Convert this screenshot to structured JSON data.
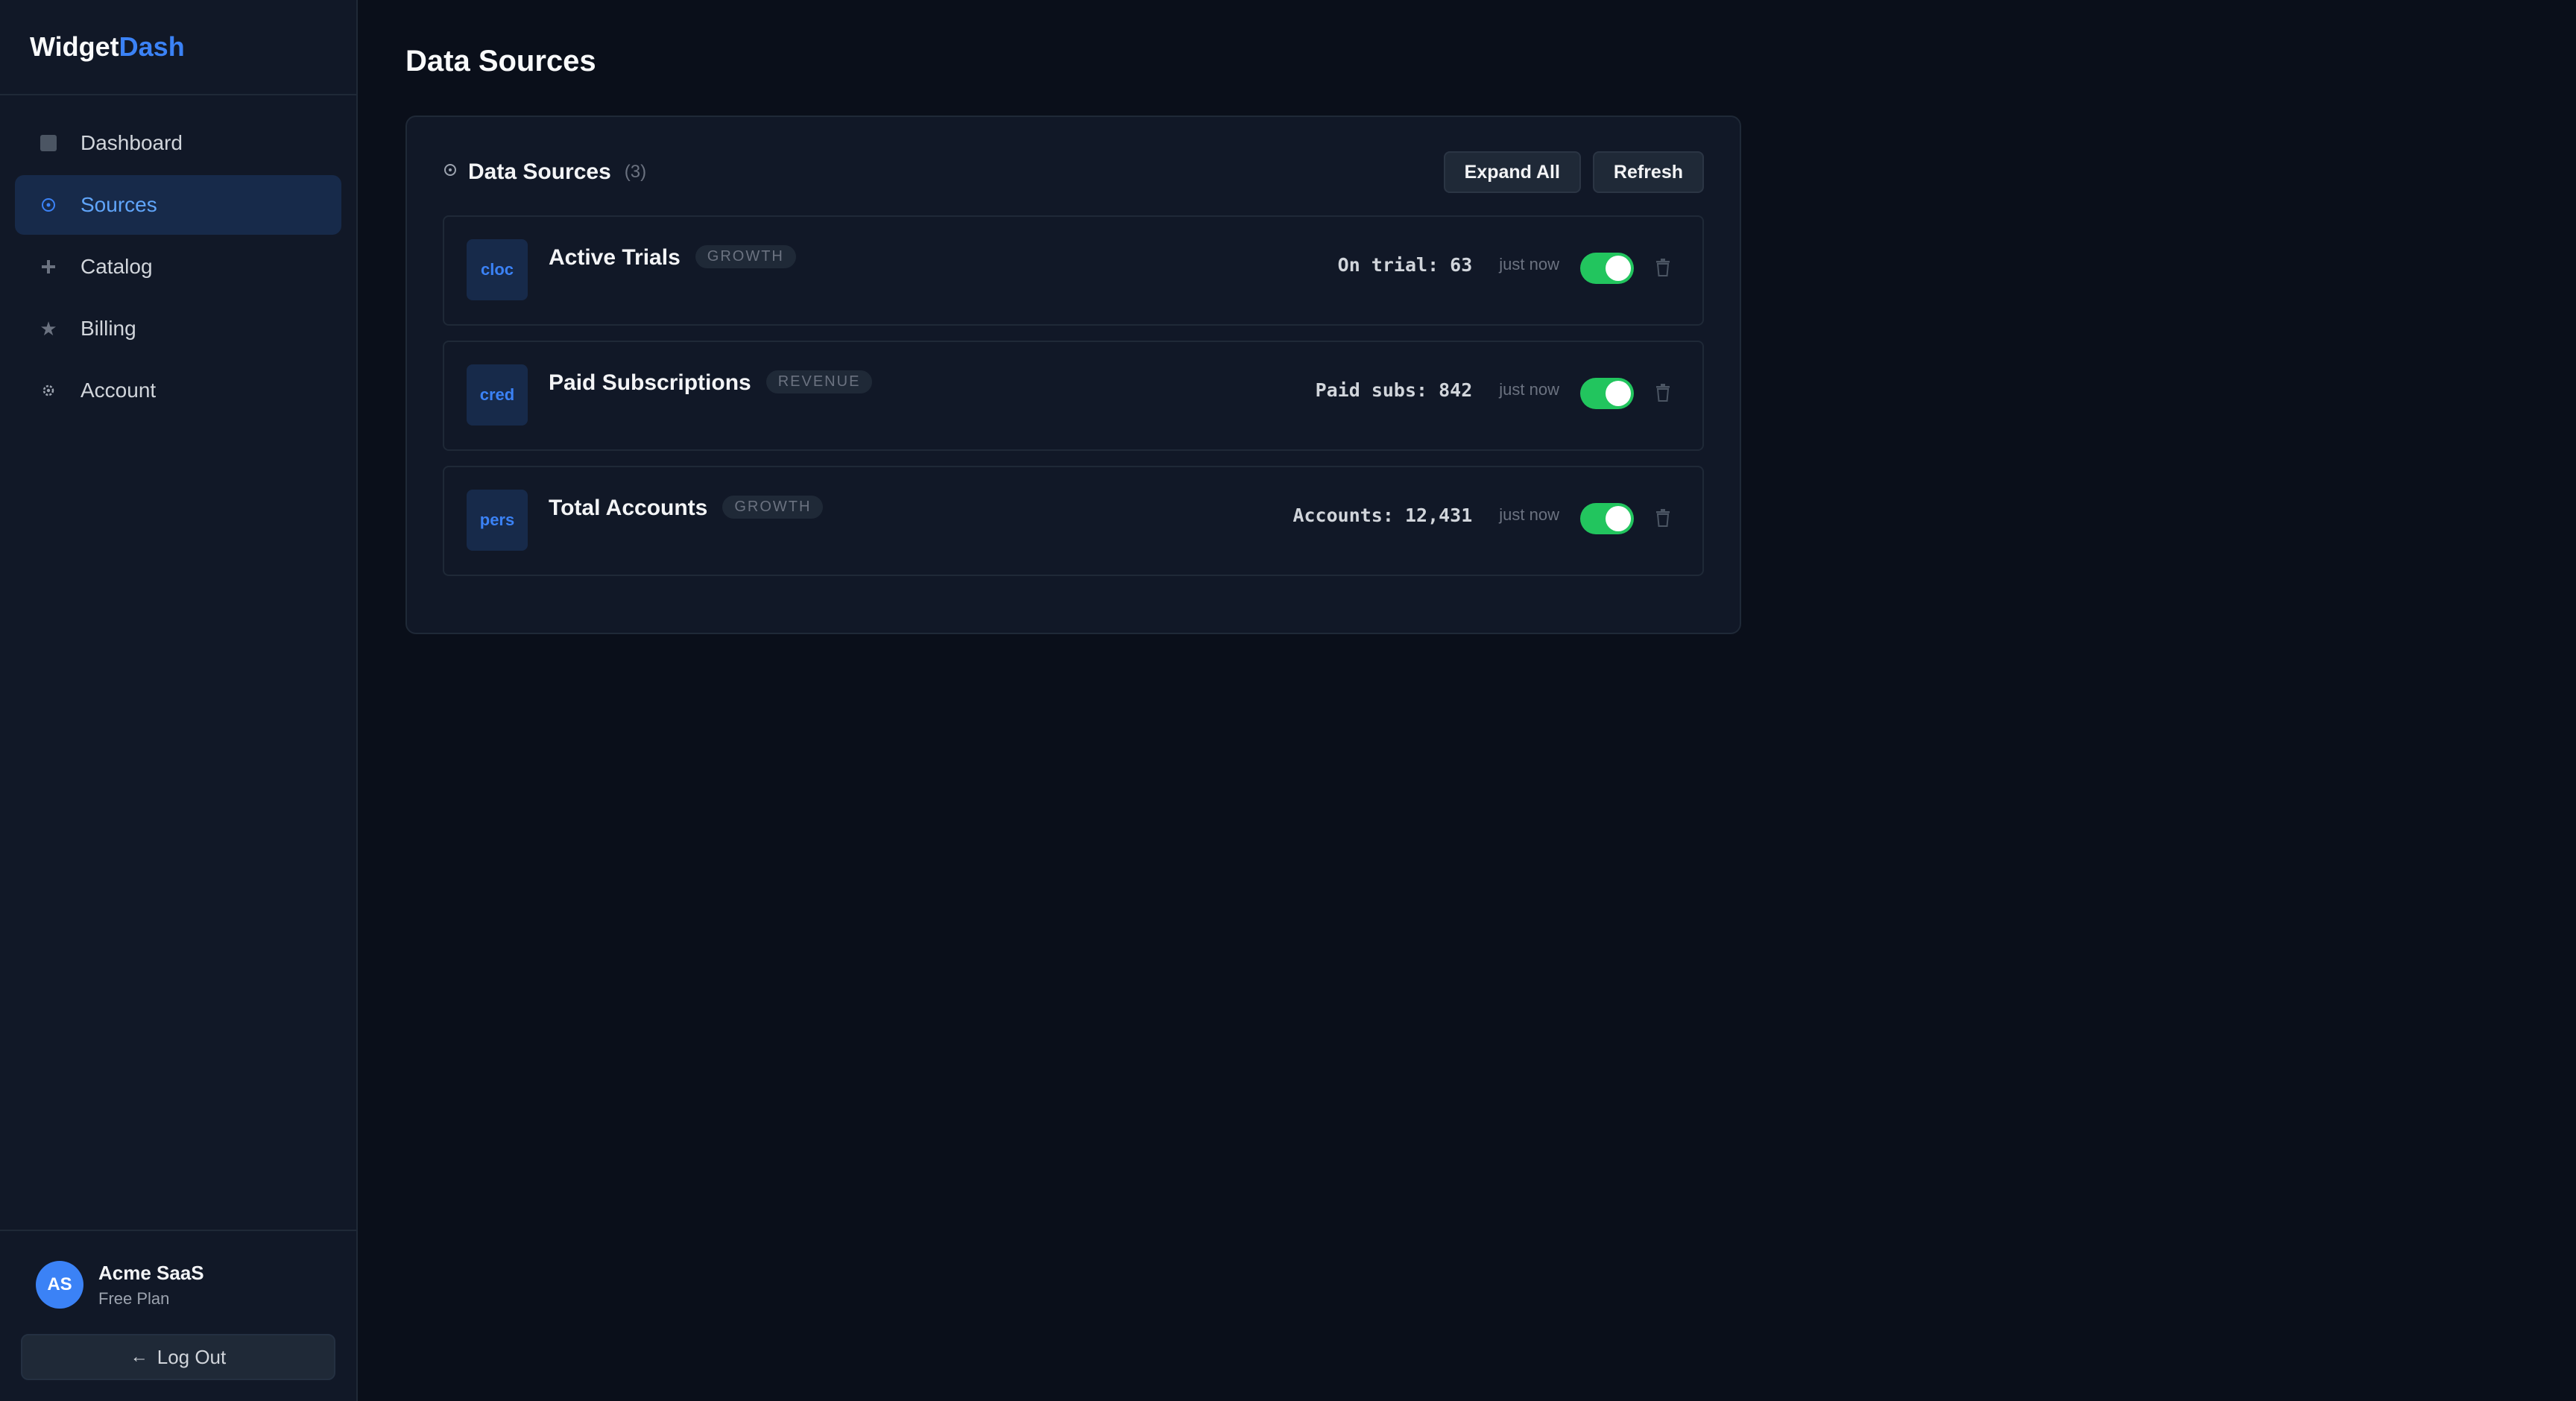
{
  "brand": {
    "part1": "Widget",
    "part2": "Dash"
  },
  "sidebar": {
    "items": [
      {
        "label": "Dashboard",
        "icon": "square-icon"
      },
      {
        "label": "Sources",
        "icon": "target-icon",
        "active": true
      },
      {
        "label": "Catalog",
        "icon": "plus-icon"
      },
      {
        "label": "Billing",
        "icon": "star-icon"
      },
      {
        "label": "Account",
        "icon": "gear-icon"
      }
    ]
  },
  "user": {
    "initials": "AS",
    "name": "Acme SaaS",
    "plan": "Free Plan"
  },
  "logout": {
    "label": "Log Out"
  },
  "page": {
    "title": "Data Sources"
  },
  "panel": {
    "title": "Data Sources",
    "count": "(3)",
    "expand_label": "Expand All",
    "refresh_label": "Refresh"
  },
  "sources": [
    {
      "badge": "cloc",
      "name": "Active Trials",
      "tag": "GROWTH",
      "metric": "On trial: 63",
      "updated": "just now",
      "enabled": true
    },
    {
      "badge": "cred",
      "name": "Paid Subscriptions",
      "tag": "REVENUE",
      "metric": "Paid subs: 842",
      "updated": "just now",
      "enabled": true
    },
    {
      "badge": "pers",
      "name": "Total Accounts",
      "tag": "GROWTH",
      "metric": "Accounts: 12,431",
      "updated": "just now",
      "enabled": true
    }
  ],
  "colors": {
    "accent": "#3b82f6",
    "toggle_on": "#22c55e",
    "bg": "#0a0f1a",
    "panel": "#111827"
  }
}
